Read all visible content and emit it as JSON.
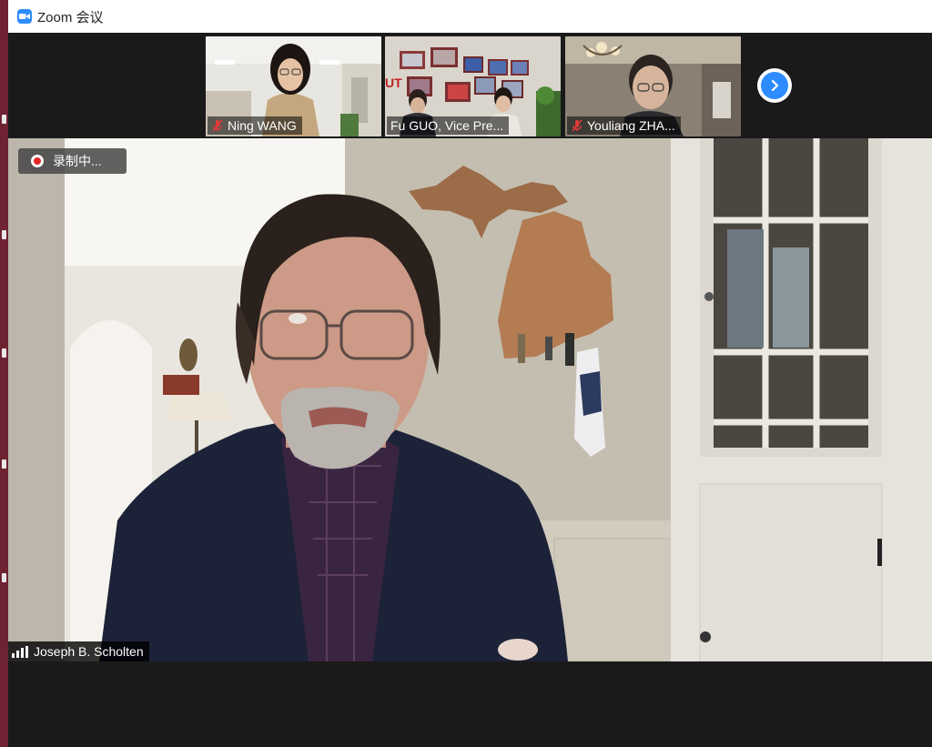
{
  "window": {
    "title": "Zoom 会议"
  },
  "gallery": {
    "participants": [
      {
        "name": "Ning WANG",
        "muted": true
      },
      {
        "name": "Fu GUO, Vice Pre...",
        "muted": false
      },
      {
        "name": "Youliang ZHA...",
        "muted": true
      }
    ],
    "next_icon": "chevron-right-icon"
  },
  "recording": {
    "label": "录制中..."
  },
  "speaker": {
    "name": "Joseph B. Scholten"
  },
  "colors": {
    "accent": "#2d8cff",
    "recording": "#e02828",
    "muted": "#e03a3a"
  }
}
